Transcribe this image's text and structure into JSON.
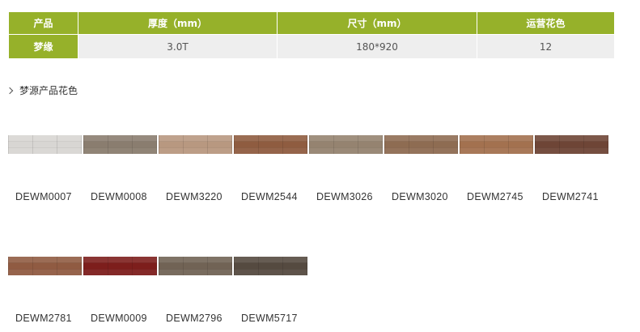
{
  "spec_table": {
    "headers": [
      "产品",
      "厚度（mm）",
      "尺寸（mm）",
      "运营花色"
    ],
    "row": [
      "梦缘",
      "3.0T",
      "180*920",
      "12"
    ],
    "header_color": "#96b12a"
  },
  "section": {
    "title": "梦源产品花色"
  },
  "swatches_row1": [
    {
      "code": "DEWM0007",
      "color": "#d8d6d3"
    },
    {
      "code": "DEWM0008",
      "color": "#8a7d6f"
    },
    {
      "code": "DEWM3220",
      "color": "#b89880"
    },
    {
      "code": "DEWM2544",
      "color": "#8f5c40"
    },
    {
      "code": "DEWM3026",
      "color": "#958370"
    },
    {
      "code": "DEWM3020",
      "color": "#8e6c52"
    },
    {
      "code": "DEWM2745",
      "color": "#a3714f"
    },
    {
      "code": "DEWM2741",
      "color": "#6e4536"
    }
  ],
  "swatches_row2": [
    {
      "code": "DEWM2781",
      "color": "#905b42"
    },
    {
      "code": "DEWM0009",
      "color": "#7d1e1c"
    },
    {
      "code": "DEWM2796",
      "color": "#716355"
    },
    {
      "code": "DEWM5717",
      "color": "#554a40"
    }
  ]
}
